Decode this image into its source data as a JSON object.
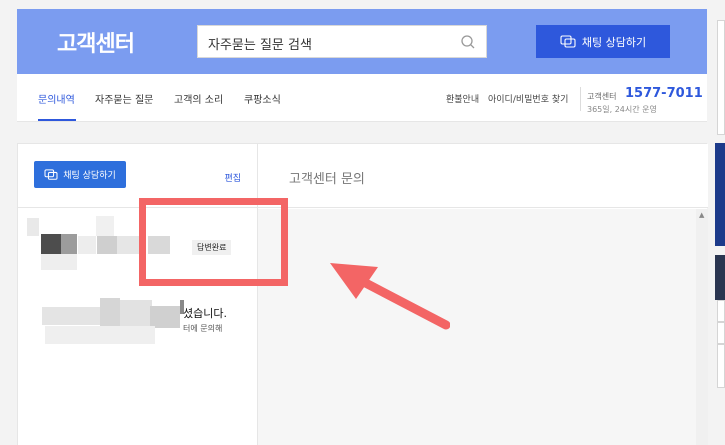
{
  "header": {
    "title": "고객센터",
    "search_text": "자주묻는 질문 검색",
    "chat_button": "채팅 상담하기"
  },
  "nav": {
    "tabs": [
      "문의내역",
      "자주묻는 질문",
      "고객의 소리",
      "쿠팡소식"
    ],
    "util_links": [
      "환불안내",
      "아이디/비밀번호 찾기"
    ],
    "cc_label": "고객센터",
    "cc_phone": "1577-7011",
    "cc_hours": "365일, 24시간 운영"
  },
  "left_panel": {
    "chat_button": "채팅 상담하기",
    "edit": "편집",
    "items": [
      {
        "badge": "답변완료"
      }
    ],
    "snippet_line1": "셨습니다.",
    "snippet_line2": "터에 문의해"
  },
  "right_panel": {
    "title": "고객센터 문의"
  },
  "colors": {
    "header_bg": "#7b9cf0",
    "primary_button": "#2e58dc",
    "annotation": "#f36565"
  },
  "icons": [
    "search-icon",
    "chat-bubble-icon",
    "scroll-up-arrow-icon",
    "annotation-arrow-icon"
  ]
}
